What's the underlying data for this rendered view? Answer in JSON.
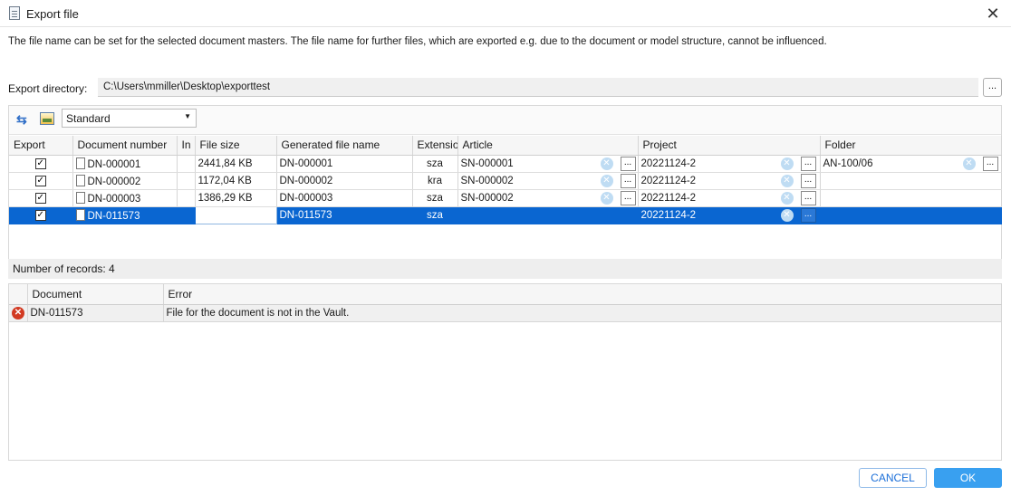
{
  "window": {
    "title": "Export file"
  },
  "description": "The file name can be set for the selected document masters. The file name for further files, which are exported e.g. due to the document or model structure, cannot be influenced.",
  "export_dir": {
    "label": "Export directory:",
    "value": "C:\\Users\\mmiller\\Desktop\\exporttest",
    "browse_label": "..."
  },
  "toolbar": {
    "view_value": "Standard"
  },
  "grid": {
    "columns": [
      "Export",
      "Document number",
      "In",
      "File size",
      "Generated file name",
      "Extensio",
      "Article",
      "Project",
      "Folder"
    ],
    "rows": [
      {
        "export": true,
        "doc": "DN-000001",
        "in": "",
        "size": "2441,84 KB",
        "gen": "DN-000001",
        "ext": "sza",
        "article": "SN-000001",
        "project": "20221124-2",
        "folder": "AN-100/06"
      },
      {
        "export": true,
        "doc": "DN-000002",
        "in": "",
        "size": "1172,04 KB",
        "gen": "DN-000002",
        "ext": "kra",
        "article": "SN-000002",
        "project": "20221124-2",
        "folder": ""
      },
      {
        "export": true,
        "doc": "DN-000003",
        "in": "",
        "size": "1386,29 KB",
        "gen": "DN-000003",
        "ext": "sza",
        "article": "SN-000002",
        "project": "20221124-2",
        "folder": ""
      },
      {
        "export": true,
        "doc": "DN-011573",
        "in": "",
        "size": "",
        "gen": "DN-011573",
        "ext": "sza",
        "article": "",
        "project": "20221124-2",
        "folder": ""
      }
    ],
    "check_glyph": "✓",
    "clear_glyph": "✕",
    "ellipsis_glyph": "..."
  },
  "records": "Number of records: 4",
  "errors": {
    "columns": [
      "Document",
      "Error"
    ],
    "rows": [
      {
        "doc": "DN-011573",
        "error": "File for the document is not in the Vault."
      }
    ],
    "error_glyph": "✕"
  },
  "buttons": {
    "cancel": "CANCEL",
    "ok": "OK"
  },
  "glyphs": {
    "close": "✕",
    "refresh": "⇆",
    "caret": "▼"
  }
}
